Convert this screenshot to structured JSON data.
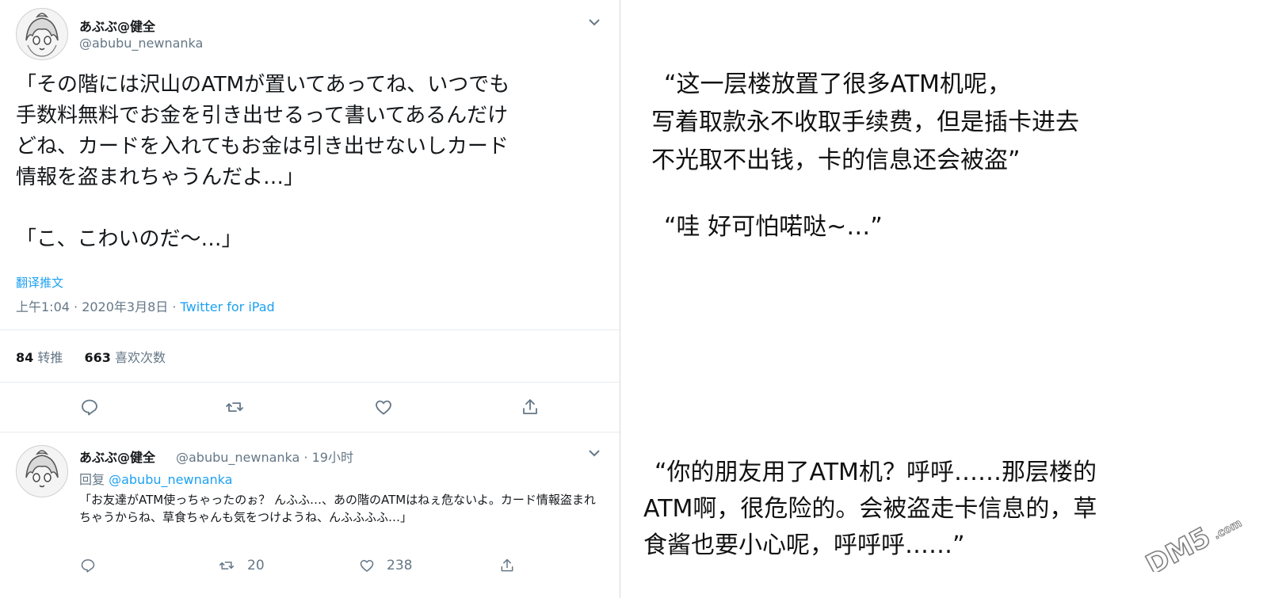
{
  "tweet": {
    "display_name": "あぶぶ@健全",
    "handle": "@abubu_newnanka",
    "text_lines": [
      "「その階には沢山のATMが置いてあってね、いつでも",
      "手数料無料でお金を引き出せるって書いてあるんだけ",
      "どね、カードを入れてもお金は引き出せないしカード",
      "情報を盗まれちゃうんだよ…」"
    ],
    "text_line2": "「こ、こわいのだ〜…」",
    "translate_label": "翻译推文",
    "timestamp": "上午1:04 · 2020年3月8日 · ",
    "source": "Twitter for iPad",
    "retweets_count": "84",
    "retweets_label": "转推",
    "likes_count": "663",
    "likes_label": "喜欢次数",
    "icons": [
      "chevron-down-icon",
      "reply-icon",
      "retweet-icon",
      "like-icon",
      "share-icon"
    ]
  },
  "reply": {
    "display_name": "あぶぶ@健全",
    "handle_time": "@abubu_newnanka · 19小时",
    "replying_prefix": "回复 ",
    "replying_to": "@abubu_newnanka",
    "text": "「お友達がATM使っちゃったのぉ？ んふふ…、あの階のATMはねぇ危ないよ。カード情報盗まれちゃうからね、草食ちゃんも気をつけようね、んふふふふ…」",
    "retweets": "20",
    "likes": "238"
  },
  "translation": {
    "block1": [
      "“这一层楼放置了很多ATM机呢，",
      "写着取款永不收取手续费，但是插卡进去",
      "不光取不出钱，卡的信息还会被盗”"
    ],
    "block2": "“哇 好可怕喏哒~…”",
    "block3": [
      "“你的朋友用了ATM机？呼呼……那层楼的",
      "ATM啊，很危险的。会被盗走卡信息的，草",
      "食酱也要小心呢，呼呼呼……”"
    ]
  },
  "watermark": "DM5.com",
  "colors": {
    "link": "#1da1f2",
    "muted": "#657786",
    "text": "#14171a"
  }
}
